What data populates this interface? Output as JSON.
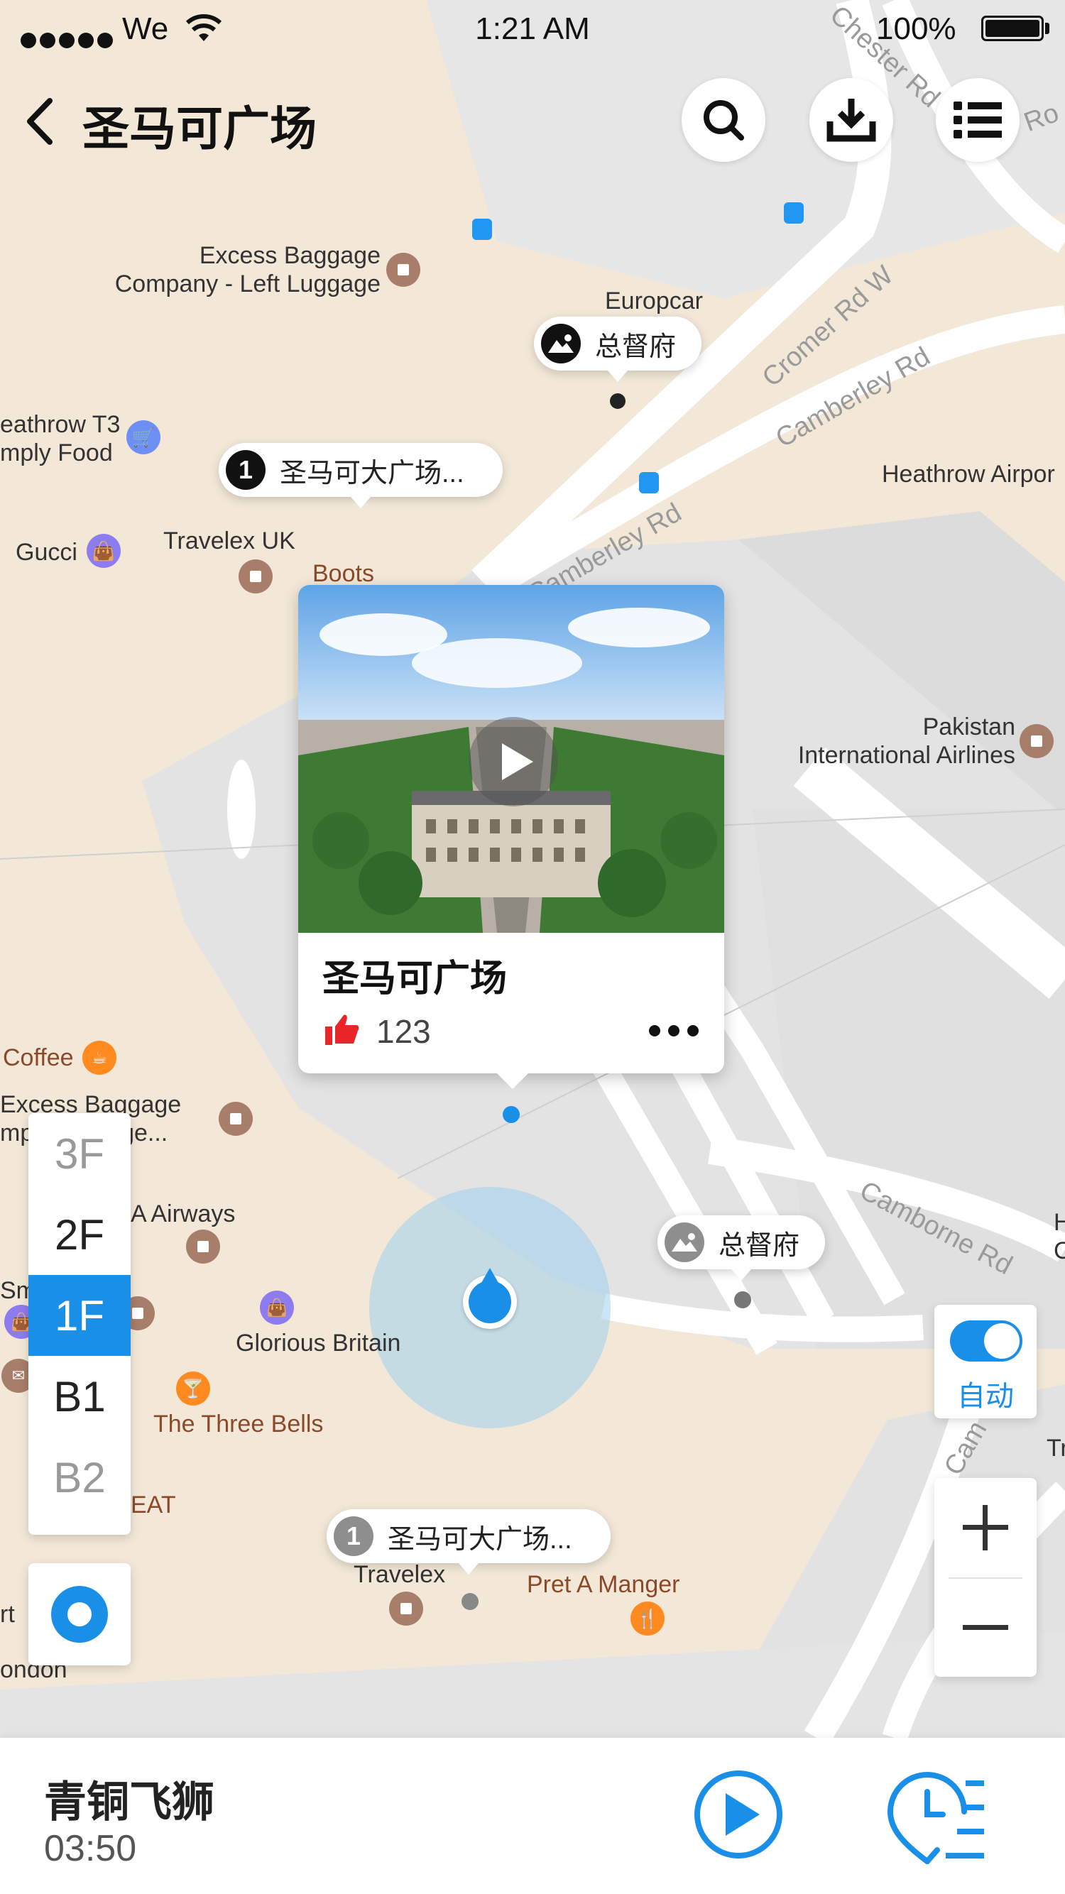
{
  "status_bar": {
    "carrier": "We",
    "time": "1:21 AM",
    "battery": "100%"
  },
  "header": {
    "title": "圣马可广场"
  },
  "map_labels": {
    "excess_baggage_top": "Excess Baggage\nCompany - Left Luggage",
    "europcar": "Europcar",
    "heathrow_t3": "eathrow T3\nmply Food",
    "gucci": "Gucci",
    "travelex_uk": "Travelex UK",
    "boots": "Boots",
    "heathrow_airport": "Heathrow Airpor",
    "pakistan": "Pakistan\nInternational Airlines",
    "coffee": "Coffee",
    "excess_baggage_mid": "Excess Baggage\nmp       ggage...",
    "airways": "A Airways",
    "glorious_britain": "Glorious Britain",
    "three_bells": "The Three Bells",
    "eat": "EAT",
    "travelex": "Travelex",
    "pret": "Pret A Manger",
    "rt": "rt",
    "ondon": "ondon",
    "sm": "Sm",
    "tr": "Tr",
    "h_c": "H\nC"
  },
  "roads": {
    "chester": "Chester Rd",
    "cromer": "Cromer Rd W",
    "camberley1": "Camberley Rd",
    "camberley2": "Camberley Rd",
    "camborne": "Camborne Rd",
    "cam": "Cam",
    "r_top": "r Ro"
  },
  "markers": {
    "governor_top": "总督府",
    "governor_bottom": "总督府",
    "stop1_active": {
      "number": "1",
      "label": "圣马可大广场..."
    },
    "stop1_inactive": {
      "number": "1",
      "label": "圣马可大广场..."
    }
  },
  "card": {
    "title": "圣马可广场",
    "likes": "123"
  },
  "floors": [
    "3F",
    "2F",
    "1F",
    "B1",
    "B2"
  ],
  "floor_selected": "1F",
  "auto_toggle": {
    "label": "自动",
    "on": true
  },
  "bottom_bar": {
    "track_title": "青铜飞狮",
    "duration": "03:50"
  },
  "colors": {
    "accent": "#1a8fe8",
    "like": "#e8262a"
  }
}
